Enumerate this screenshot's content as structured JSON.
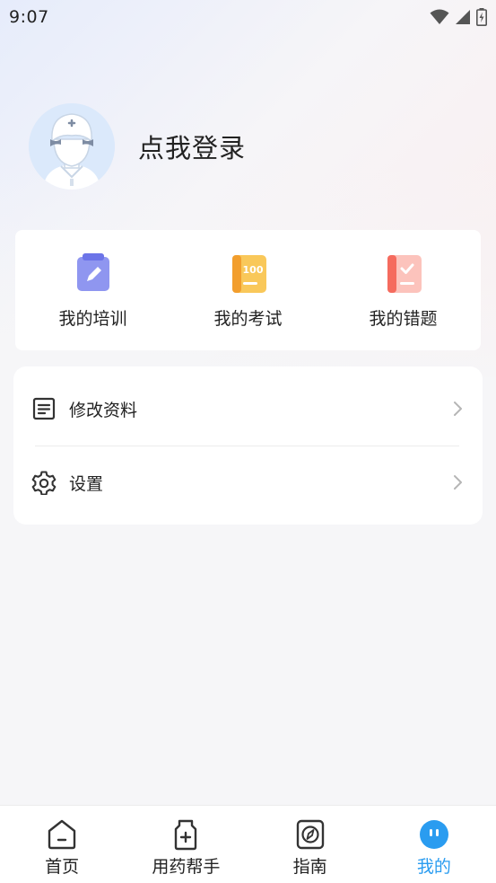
{
  "status_bar": {
    "time": "9:07"
  },
  "profile": {
    "login_label": "点我登录"
  },
  "quick_actions": [
    {
      "label": "我的培训",
      "icon": "clipboard-edit-icon",
      "color": "#8f96f0"
    },
    {
      "label": "我的考试",
      "icon": "exam-book-icon",
      "color": "#f7b733",
      "badge": "100"
    },
    {
      "label": "我的错题",
      "icon": "wrong-book-icon",
      "color": "#f56b5e"
    }
  ],
  "menu": [
    {
      "label": "修改资料",
      "icon": "document-list-icon"
    },
    {
      "label": "设置",
      "icon": "gear-icon"
    }
  ],
  "tabbar": {
    "active_color": "#2a9cf0",
    "items": [
      {
        "label": "首页",
        "icon": "home-icon"
      },
      {
        "label": "用药帮手",
        "icon": "medicine-bottle-icon"
      },
      {
        "label": "指南",
        "icon": "compass-icon"
      },
      {
        "label": "我的",
        "icon": "profile-face-icon",
        "active": true
      }
    ]
  }
}
